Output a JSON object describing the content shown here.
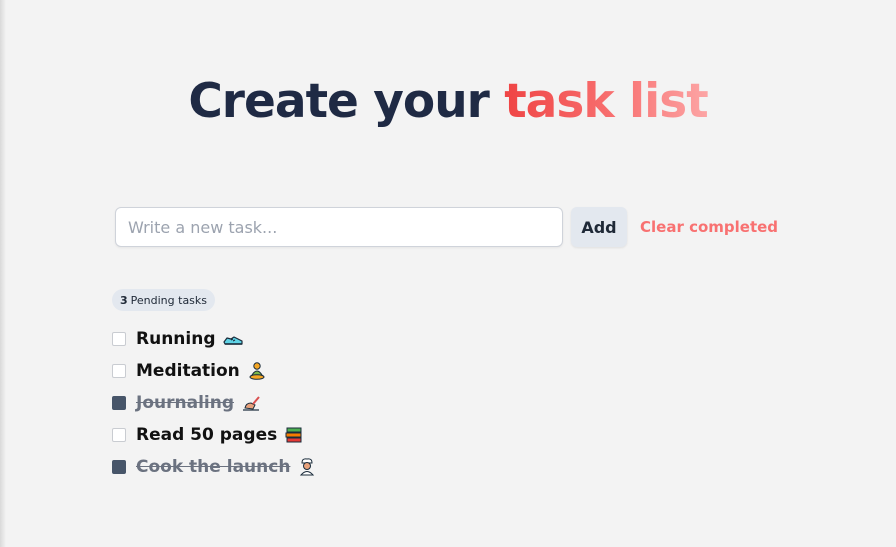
{
  "header": {
    "title_main": "Create your ",
    "title_accent": "task list"
  },
  "form": {
    "input_placeholder": "Write a new task...",
    "input_value": "",
    "add_label": "Add",
    "clear_label": "Clear completed"
  },
  "pending": {
    "count": "3",
    "label": "Pending tasks"
  },
  "tasks": [
    {
      "label": "Running",
      "done": false,
      "icon": "running-shoe-icon"
    },
    {
      "label": "Meditation",
      "done": false,
      "icon": "meditation-icon"
    },
    {
      "label": "Journaling",
      "done": true,
      "icon": "writing-hand-icon"
    },
    {
      "label": "Read 50 pages",
      "done": false,
      "icon": "books-icon"
    },
    {
      "label": "Cook the launch",
      "done": true,
      "icon": "cook-icon"
    }
  ],
  "colors": {
    "title": "#1f2a44",
    "accent_start": "#ef4444",
    "accent_end": "#fca5a5",
    "checked_box": "#475569",
    "clear_link": "#f87171"
  }
}
